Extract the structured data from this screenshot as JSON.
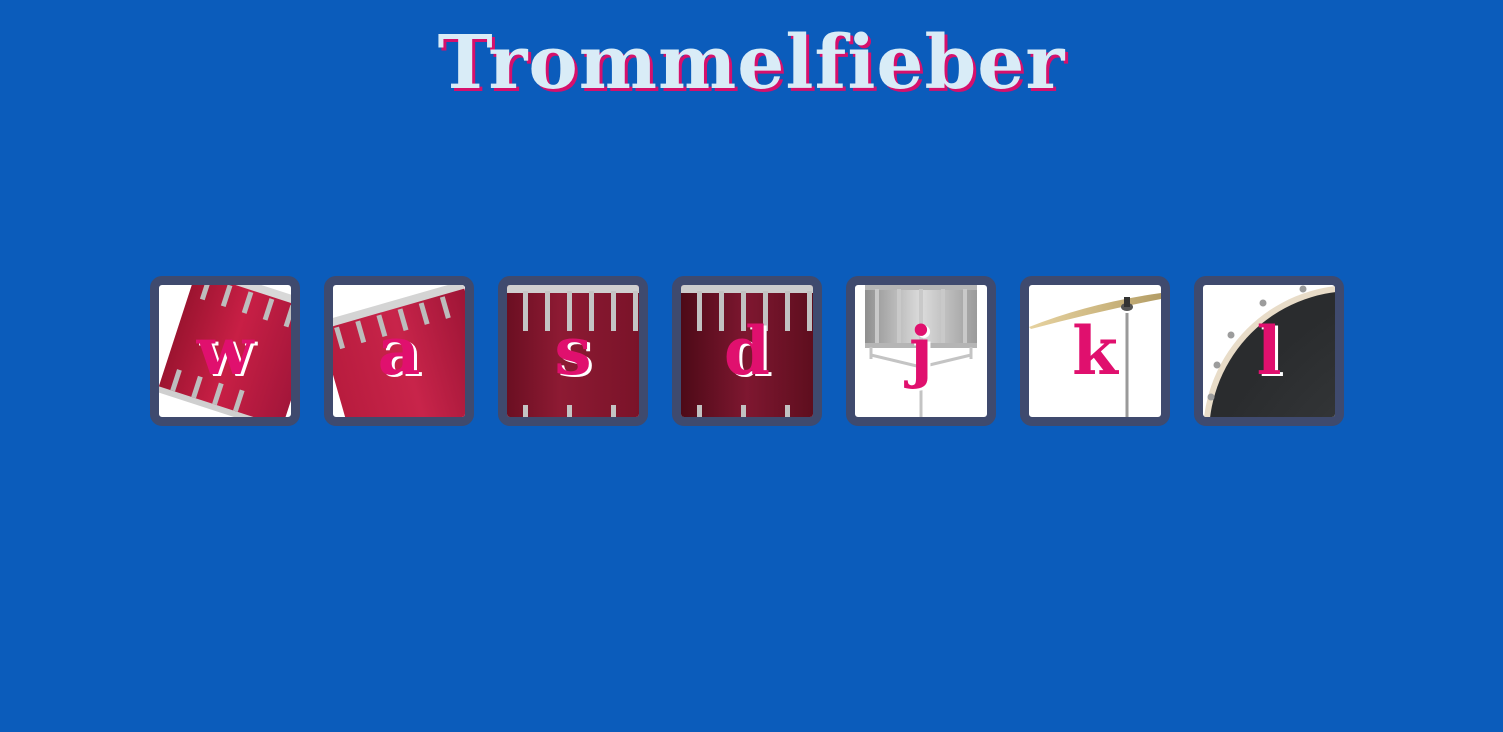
{
  "title": "Trommelfieber",
  "drums": [
    {
      "key": "w",
      "icon": "floor-tom-icon"
    },
    {
      "key": "a",
      "icon": "tom-icon"
    },
    {
      "key": "s",
      "icon": "snare-drum-icon"
    },
    {
      "key": "d",
      "icon": "bass-drum-icon"
    },
    {
      "key": "j",
      "icon": "snare-stand-icon"
    },
    {
      "key": "k",
      "icon": "cymbal-icon"
    },
    {
      "key": "l",
      "icon": "kick-drum-icon"
    }
  ],
  "colors": {
    "background": "#0b5cbb",
    "title": "#d9ecf7",
    "title_shadow": "#d6106c",
    "key_letter": "#e0106e",
    "tile_border": "#3f4a6e"
  }
}
